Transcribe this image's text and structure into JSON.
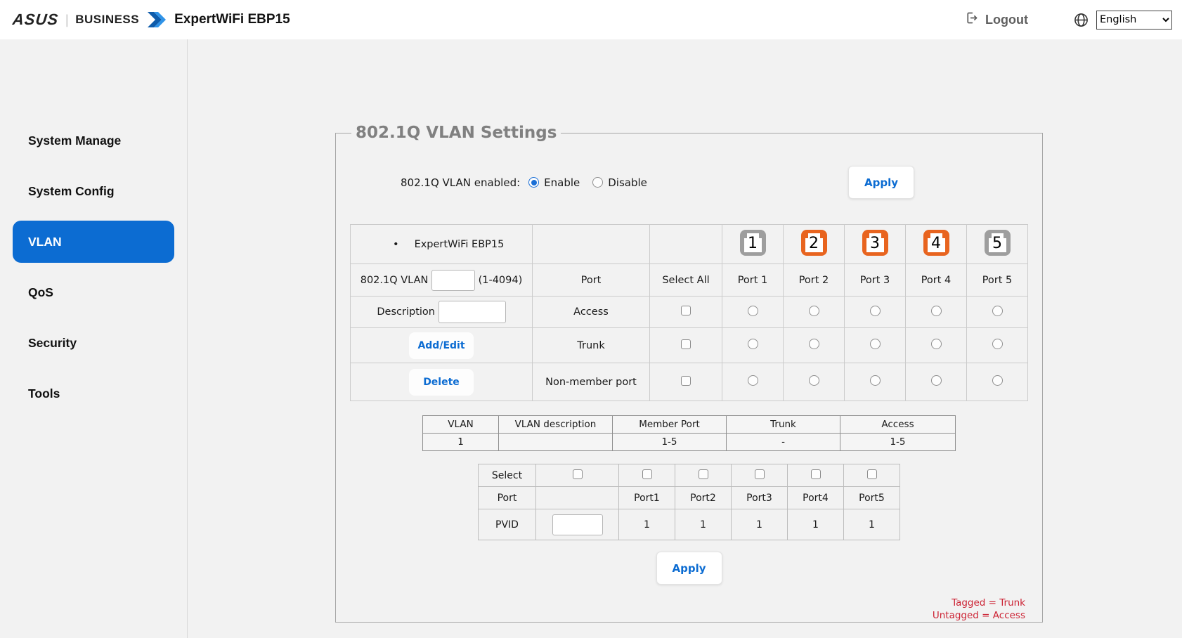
{
  "header": {
    "brand_asus": "ASUS",
    "brand_separator": "|",
    "brand_business": "BUSINESS",
    "product_title": "ExpertWiFi EBP15",
    "logout_label": "Logout",
    "language_selected": "English",
    "icons": {
      "logout": "exit-door-arrow",
      "language": "globe",
      "brand": "double-chevron-right"
    }
  },
  "sidebar": {
    "items": [
      {
        "label": "System Manage",
        "active": false
      },
      {
        "label": "System Config",
        "active": false
      },
      {
        "label": "VLAN",
        "active": true
      },
      {
        "label": "QoS",
        "active": false
      },
      {
        "label": "Security",
        "active": false
      },
      {
        "label": "Tools",
        "active": false
      }
    ]
  },
  "main": {
    "panel_title": "802.1Q VLAN Settings",
    "enable_row": {
      "label": "802.1Q VLAN enabled:",
      "options": [
        {
          "label": "Enable",
          "checked": true
        },
        {
          "label": "Disable",
          "checked": false
        }
      ],
      "apply_label": "Apply"
    },
    "port_table": {
      "device_bullet": "•",
      "device_label": "ExpertWiFi EBP15",
      "vlan_label": "802.1Q VLAN",
      "vlan_value": "",
      "vlan_range": "(1-4094)",
      "port_header": "Port",
      "select_all_header": "Select All",
      "description_label": "Description",
      "description_value": "",
      "add_edit_label": "Add/Edit",
      "delete_label": "Delete",
      "row_access": "Access",
      "row_trunk": "Trunk",
      "row_non_member": "Non-member port",
      "ports": [
        {
          "num": "1",
          "header": "Port 1",
          "state": "gray"
        },
        {
          "num": "2",
          "header": "Port 2",
          "state": "orange"
        },
        {
          "num": "3",
          "header": "Port 3",
          "state": "orange"
        },
        {
          "num": "4",
          "header": "Port 4",
          "state": "orange"
        },
        {
          "num": "5",
          "header": "Port 5",
          "state": "gray"
        }
      ]
    },
    "vlan_table": {
      "headers": [
        "VLAN",
        "VLAN description",
        "Member Port",
        "Trunk",
        "Access"
      ],
      "rows": [
        {
          "vlan": "1",
          "description": "",
          "member_port": "1-5",
          "trunk": "-",
          "access": "1-5"
        }
      ]
    },
    "pvid_table": {
      "select_label": "Select",
      "port_label": "Port",
      "pvid_label": "PVID",
      "pvid_value": "",
      "port_headers": [
        "Port1",
        "Port2",
        "Port3",
        "Port4",
        "Port5"
      ],
      "pvid_values": [
        "1",
        "1",
        "1",
        "1",
        "1"
      ]
    },
    "apply_label": "Apply",
    "notes": [
      "Tagged = Trunk",
      "Untagged = Access"
    ]
  },
  "colors": {
    "accent_blue": "#0c6cd2",
    "port_orange": "#e8641f",
    "port_gray": "#9e9e9e",
    "note_red": "#cc2233",
    "legend_gray": "#808080"
  }
}
